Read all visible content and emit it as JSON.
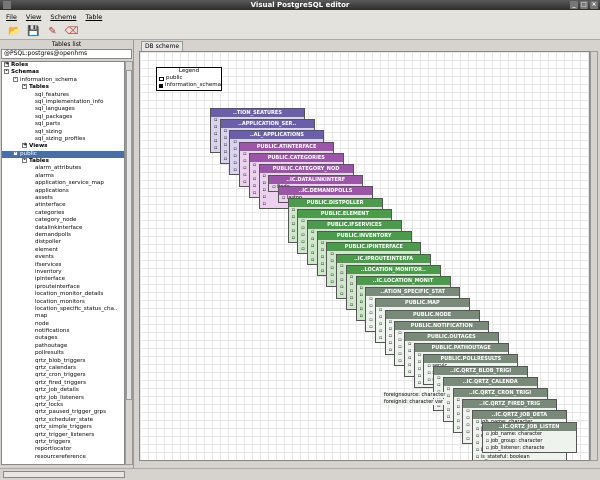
{
  "window": {
    "title": "Visual PostgreSQL editor"
  },
  "menu": [
    "File",
    "View",
    "Scheme",
    "Table"
  ],
  "toolbar": [
    {
      "name": "open-icon",
      "glyph": "📂"
    },
    {
      "name": "save-icon",
      "glyph": "💾"
    },
    {
      "name": "pencil-icon",
      "glyph": "✎"
    },
    {
      "name": "eraser-icon",
      "glyph": "⌫"
    }
  ],
  "left_panel": {
    "title": "Tables list",
    "connection": "@PSQL:postgres@openhms",
    "tree": [
      {
        "label": "Roles",
        "level": 0,
        "toggle": "+",
        "bold": true
      },
      {
        "label": "Schemas",
        "level": 0,
        "toggle": "-",
        "bold": true
      },
      {
        "label": "information_schema",
        "level": 1,
        "toggle": "-"
      },
      {
        "label": "Tables",
        "level": 2,
        "toggle": "-",
        "bold": true
      },
      {
        "label": "sql_features",
        "level": 3
      },
      {
        "label": "sql_implementation_info",
        "level": 3
      },
      {
        "label": "sql_languages",
        "level": 3
      },
      {
        "label": "sql_packages",
        "level": 3
      },
      {
        "label": "sql_parts",
        "level": 3
      },
      {
        "label": "sql_sizing",
        "level": 3
      },
      {
        "label": "sql_sizing_profiles",
        "level": 3
      },
      {
        "label": "Views",
        "level": 2,
        "toggle": "+",
        "bold": true
      },
      {
        "label": "public",
        "level": 1,
        "toggle": "-",
        "selected": true
      },
      {
        "label": "Tables",
        "level": 2,
        "toggle": "-",
        "bold": true
      },
      {
        "label": "alarm_attributes",
        "level": 3
      },
      {
        "label": "alarms",
        "level": 3
      },
      {
        "label": "application_service_map",
        "level": 3
      },
      {
        "label": "applications",
        "level": 3
      },
      {
        "label": "assets",
        "level": 3
      },
      {
        "label": "atinterface",
        "level": 3
      },
      {
        "label": "categories",
        "level": 3
      },
      {
        "label": "category_node",
        "level": 3
      },
      {
        "label": "datalinkinterface",
        "level": 3
      },
      {
        "label": "demandpolls",
        "level": 3
      },
      {
        "label": "distpoller",
        "level": 3
      },
      {
        "label": "element",
        "level": 3
      },
      {
        "label": "events",
        "level": 3
      },
      {
        "label": "ifservices",
        "level": 3
      },
      {
        "label": "inventory",
        "level": 3
      },
      {
        "label": "ipinterface",
        "level": 3
      },
      {
        "label": "iprouteinterface",
        "level": 3
      },
      {
        "label": "location_monitor_details",
        "level": 3
      },
      {
        "label": "location_monitors",
        "level": 3
      },
      {
        "label": "location_specific_status_cha..",
        "level": 3
      },
      {
        "label": "map",
        "level": 3
      },
      {
        "label": "node",
        "level": 3
      },
      {
        "label": "notifications",
        "level": 3
      },
      {
        "label": "outages",
        "level": 3
      },
      {
        "label": "pathoutage",
        "level": 3
      },
      {
        "label": "pollresults",
        "level": 3
      },
      {
        "label": "qrtz_blob_triggers",
        "level": 3
      },
      {
        "label": "qrtz_calendars",
        "level": 3
      },
      {
        "label": "qrtz_cron_triggers",
        "level": 3
      },
      {
        "label": "qrtz_fired_triggers",
        "level": 3
      },
      {
        "label": "qrtz_job_details",
        "level": 3
      },
      {
        "label": "qrtz_job_listeners",
        "level": 3
      },
      {
        "label": "qrtz_locks",
        "level": 3
      },
      {
        "label": "qrtz_paused_trigger_grps",
        "level": 3
      },
      {
        "label": "qrtz_scheduler_state",
        "level": 3
      },
      {
        "label": "qrtz_simple_triggers",
        "level": 3
      },
      {
        "label": "qrtz_trigger_listeners",
        "level": 3
      },
      {
        "label": "qrtz_triggers",
        "level": 3
      },
      {
        "label": "reportlocator",
        "level": 3
      },
      {
        "label": "resourcereference",
        "level": 3
      }
    ]
  },
  "tab": {
    "label": "DB scheme"
  },
  "legend": {
    "title": "Legend",
    "items": [
      {
        "label": "public",
        "color": "#ffffff"
      },
      {
        "label": "information_schema",
        "color": "#000000"
      }
    ]
  },
  "colors": {
    "info_header": "#6a5fa8",
    "info_body": "#d9d3ef",
    "purple_header": "#9c56a8",
    "purple_body": "#ecd2ee",
    "green_header": "#4c9a4c",
    "green_body": "#cfe8cc",
    "gray_header": "#7a8a7a",
    "gray_body": "#eef3ee"
  },
  "diagram_tables": [
    {
      "title": "..TION_SEATURES",
      "theme": "info",
      "rows": []
    },
    {
      "title": "..APPLICATION_SER..",
      "theme": "info",
      "rows": []
    },
    {
      "title": "..AL_APPLICATIONS",
      "theme": "info",
      "rows": []
    },
    {
      "title": "PUBLIC.ATINTERFACE",
      "theme": "purple",
      "rows": []
    },
    {
      "title": "PUBLIC.CATEGORIES",
      "theme": "purple",
      "rows": []
    },
    {
      "title": "PUBLIC.CATEGORY_NOD",
      "theme": "purple",
      "rows": []
    },
    {
      "title": "..IC.DATALINKINTERF",
      "theme": "purple",
      "rows": [
        "finde"
      ]
    },
    {
      "title": "..IC.DEMANDPOLLS",
      "theme": "purple",
      "rows": [
        "lastpo"
      ]
    },
    {
      "title": "PUBLIC.DISTPOLLER",
      "theme": "green",
      "rows": []
    },
    {
      "title": "PUBLIC.ELEMENT",
      "theme": "green",
      "rows": []
    },
    {
      "title": "PUBLIC.IFSERVICES",
      "theme": "green",
      "rows": []
    },
    {
      "title": "PUBLIC.INVENTORY",
      "theme": "green",
      "rows": []
    },
    {
      "title": "PUBLIC.IPINTERFACE",
      "theme": "green",
      "rows": []
    },
    {
      "title": "..IC.IPROUTEINTERFA",
      "theme": "green",
      "rows": []
    },
    {
      "title": "..LOCATION_MONITOR..",
      "theme": "green",
      "rows": []
    },
    {
      "title": "..IC.LOCATION_MONIT",
      "theme": "green",
      "rows": []
    },
    {
      "title": "..ATION_SPECIFIC_STAT",
      "theme": "gray",
      "rows": []
    },
    {
      "title": "PUBLIC.MAP",
      "theme": "gray",
      "rows": []
    },
    {
      "title": "PUBLIC.NODE",
      "theme": "gray",
      "rows": []
    },
    {
      "title": "PUBLIC.NOTIFICATION",
      "theme": "gray",
      "rows": []
    },
    {
      "title": "PUBLIC.OUTAGES",
      "theme": "gray",
      "rows": []
    },
    {
      "title": "PUBLIC.PATHOUTAGE",
      "theme": "gray",
      "rows": []
    },
    {
      "title": "PUBLIC.POLLRESULTS",
      "theme": "gray",
      "rows": [
        "servic",
        "statusc",
        "reason"
      ]
    },
    {
      "title": "..IC.QRTZ_BLOB_TRIGI",
      "theme": "gray",
      "rows": []
    },
    {
      "title": "..IC.QRTZ_CALENDA",
      "theme": "gray",
      "rows": []
    },
    {
      "title": "..IC.QRTZ_CRON_TRIGI",
      "theme": "gray",
      "rows": []
    },
    {
      "title": "..IC.QRTZ_FIRED_TRIG",
      "theme": "gray",
      "rows": []
    },
    {
      "title": "..IC.QRTZ_JOB_DETA",
      "theme": "gray",
      "rows": [
        "job_name: character",
        "job_group: characte",
        "description: charact",
        "",
        "is_volatile: boolean",
        "is_stateful: boolean",
        "requests_recovery: b",
        "job_data: bytea"
      ]
    },
    {
      "title": "..IC.QRTZ_JOB_LISTEN",
      "theme": "gray",
      "rows": [
        "job_name: character",
        "job_group: character",
        "job_listener: characte"
      ]
    }
  ],
  "stray_rows": [
    "foreignsource: character",
    "foreignid: character var"
  ]
}
